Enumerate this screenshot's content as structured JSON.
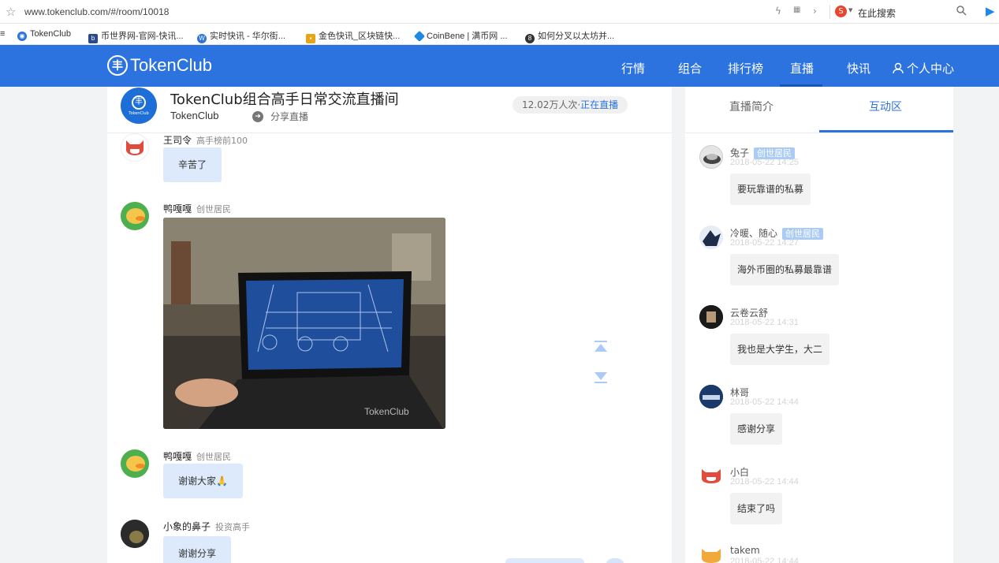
{
  "browser": {
    "url": "www.tokenclub.com/#/room/10018",
    "search_placeholder": "在此搜索",
    "bookmarks": [
      {
        "label": "TokenClub",
        "color": "#2d73e0"
      },
      {
        "label": "币世界网-官网-快讯...",
        "color": "#2a4a8c"
      },
      {
        "label": "实时快讯 - 华尔街...",
        "color": "#2d73e0"
      },
      {
        "label": "金色快讯_区块链快...",
        "color": "#e8a317"
      },
      {
        "label": "CoinBene | 满币网 ...",
        "color": "#1e88e5"
      },
      {
        "label": "如何分叉以太坊并...",
        "color": "#333333"
      }
    ]
  },
  "nav": {
    "logo": "TokenClub",
    "items": [
      "行情",
      "组合",
      "排行榜",
      "直播",
      "快讯",
      "个人中心"
    ],
    "active": "直播",
    "color": "#2d73e0"
  },
  "room": {
    "title": "TokenClub组合高手日常交流直播间",
    "owner": "TokenClub",
    "share": "分享直播",
    "viewers": "12.02万人次·",
    "status": "正在直播"
  },
  "messages": [
    {
      "name": "王司令",
      "role": "高手榜前100",
      "text": "辛苦了"
    },
    {
      "name": "鸭嘎嘎",
      "role": "创世居民",
      "image_watermark": "TokenClub"
    },
    {
      "name": "鸭嘎嘎",
      "role": "创世居民",
      "text": "谢谢大家🙏"
    },
    {
      "name": "小象的鼻子",
      "role": "投资高手",
      "text": "谢谢分享"
    }
  ],
  "sidebar": {
    "tabs": [
      "直播简介",
      "互动区"
    ],
    "active_tab": "互动区",
    "comments": [
      {
        "name": "兔子",
        "badge": "创世居民",
        "time": "2018-05-22 14:25",
        "text": "要玩靠谱的私募"
      },
      {
        "name": "冷暖、随心",
        "badge": "创世居民",
        "time": "2018-05-22 14:27",
        "text": "海外币圈的私募最靠谱"
      },
      {
        "name": "云卷云舒",
        "time": "2018-05-22 14:31",
        "text": "我也是大学生，大二"
      },
      {
        "name": "林哥",
        "time": "2018-05-22 14:44",
        "text": "感谢分享"
      },
      {
        "name": "小白",
        "time": "2018-05-22 14:44",
        "text": "结束了吗"
      },
      {
        "name": "takem",
        "time": "2018-05-22 14:44"
      }
    ]
  }
}
